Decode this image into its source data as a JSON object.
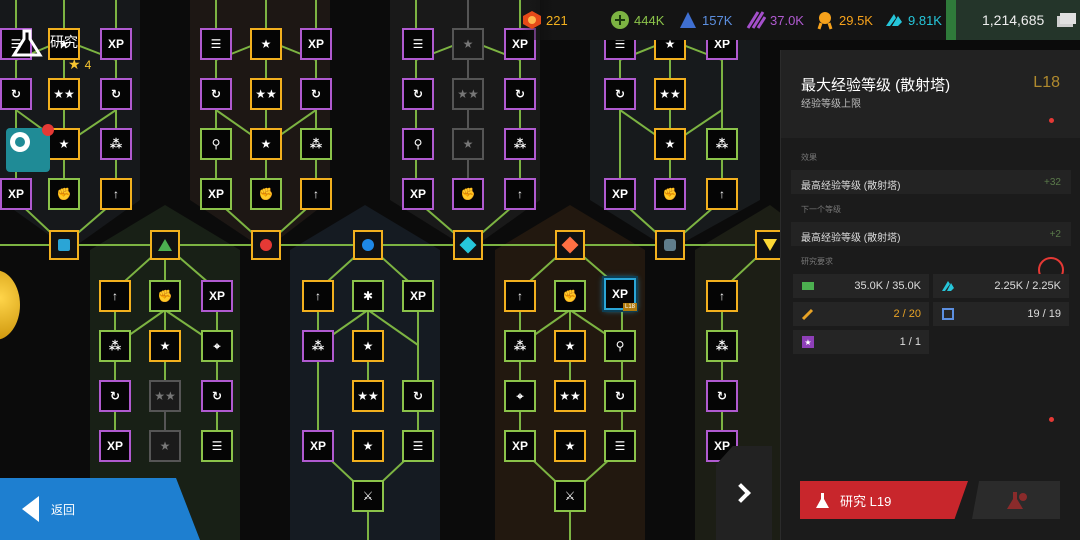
{
  "header": {
    "title": "研究",
    "stars": "4"
  },
  "resources": {
    "tokens": "221",
    "green": "444K",
    "blue": "157K",
    "purple": "37.0K",
    "orange": "29.5K",
    "cyan": "9.81K",
    "money": "1,214,685"
  },
  "panel": {
    "title": "最大经验等级 (散射塔)",
    "subtitle": "经验等级上限",
    "level": "L18",
    "effect_label": "效果",
    "effect_name": "最高经验等级 (散射塔)",
    "effect_value": "+32",
    "next_label": "下一个等级",
    "next_name": "最高经验等级 (散射塔)",
    "next_value": "+2",
    "req_label": "研究要求",
    "requirements": [
      {
        "icon": "cash-icon",
        "value": "35.0K / 35.0K"
      },
      {
        "icon": "cyan-crystal-icon",
        "value": "2.25K / 2.25K"
      },
      {
        "icon": "blueprint-icon",
        "value": "2 / 20"
      },
      {
        "icon": "scanner-icon",
        "value": "19 / 19"
      },
      {
        "icon": "star-card-icon",
        "value": "1 / 1"
      }
    ],
    "research_button": "研究 L19"
  },
  "nav": {
    "back": "返回"
  },
  "tree": {
    "selected_node": "L18"
  },
  "colors": {
    "accent_gold": "#f2b01e",
    "accent_green": "#8bc34a",
    "accent_purple": "#b05ad0",
    "research_red": "#c8262c",
    "back_blue": "#1e7fd0"
  }
}
